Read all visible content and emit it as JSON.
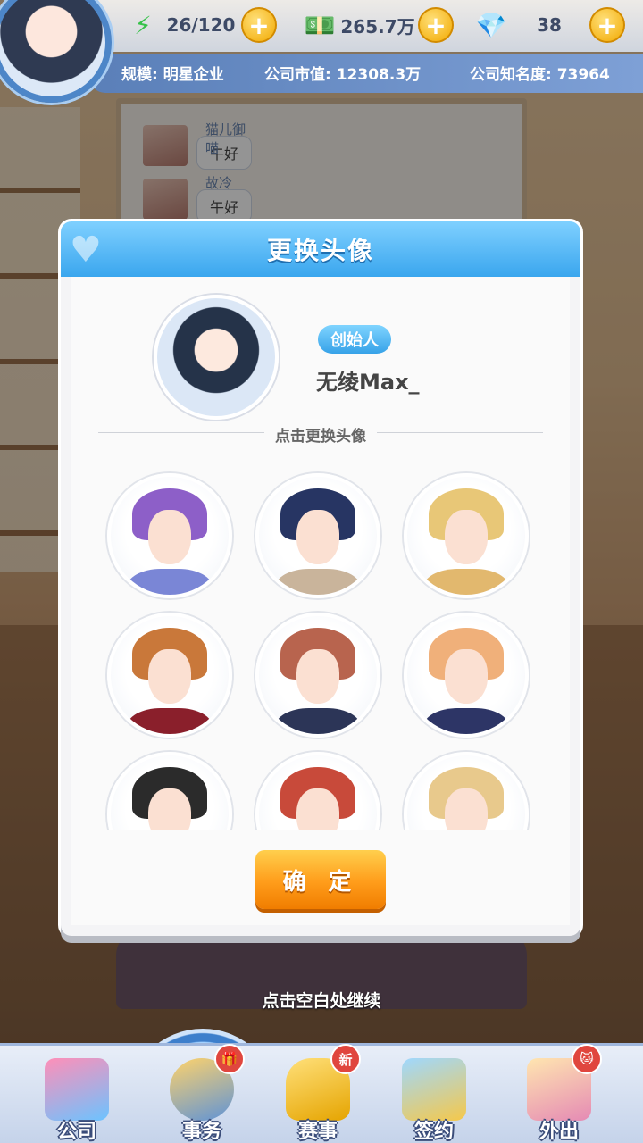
{
  "hud": {
    "energy_value": "26/120",
    "money_value": "265.7万",
    "gem_value": "38",
    "scale_label": "规模: 明星企业",
    "market_value_label": "公司市值: 12308.3万",
    "fame_label": "公司知名度: 73964",
    "plus_symbol": "+"
  },
  "chat_preview": [
    {
      "name": "猫儿御喵",
      "message": "午好"
    },
    {
      "name": "故冷",
      "message": "午好"
    }
  ],
  "modal": {
    "title": "更换头像",
    "role_badge": "创始人",
    "user_name": "无绫Max_",
    "divider_text": "点击更换头像",
    "confirm_label": "确 定",
    "portraits": [
      {
        "id": "purple-hair-girl",
        "hair_color": "#8d5fc8",
        "outfit_color": "#7a86d6"
      },
      {
        "id": "navy-hair-girl",
        "hair_color": "#273563",
        "outfit_color": "#c9b49b"
      },
      {
        "id": "blonde-mask-man",
        "hair_color": "#e8c777",
        "outfit_color": "#e2b86e"
      },
      {
        "id": "ginger-man-red-shirt",
        "hair_color": "#c9783a",
        "outfit_color": "#8a1f2b"
      },
      {
        "id": "auburn-man-navy-shirt",
        "hair_color": "#b8644e",
        "outfit_color": "#2c3557"
      },
      {
        "id": "blonde-bearded-man",
        "hair_color": "#f0b07a",
        "outfit_color": "#2d3566"
      },
      {
        "id": "captain-hat-man",
        "hair_color": "#2b2b2b",
        "outfit_color": "#f0f0f0"
      },
      {
        "id": "red-bandana-man",
        "hair_color": "#c84a3a",
        "outfit_color": "#5b5b5b"
      },
      {
        "id": "blonde-twin-tail-girl",
        "hair_color": "#e8c98c",
        "outfit_color": "#d8b08a"
      }
    ]
  },
  "continue_hint": "点击空白处继续",
  "nav": [
    {
      "label": "公司",
      "icon": "company-icon",
      "badge": ""
    },
    {
      "label": "事务",
      "icon": "affairs-icon",
      "badge": "gift"
    },
    {
      "label": "赛事",
      "icon": "trophy-icon",
      "badge": "新"
    },
    {
      "label": "签约",
      "icon": "contract-icon",
      "badge": ""
    },
    {
      "label": "外出",
      "icon": "door-icon",
      "badge": "cat"
    }
  ],
  "colors": {
    "accent_blue": "#3aa6ee",
    "confirm_orange": "#ff9c1a",
    "badge_red": "#e0463e"
  }
}
